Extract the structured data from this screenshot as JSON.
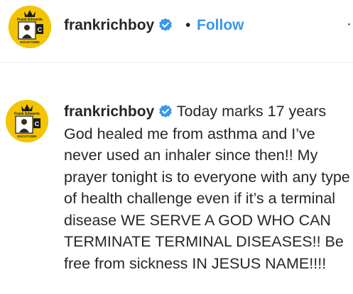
{
  "post_header": {
    "username": "frankrichboy",
    "separator": "•",
    "follow_label": "Follow",
    "more_label": "·"
  },
  "avatar": {
    "top_text": "Frank Edwards",
    "letter": "C",
    "bottom_text": "ROCKTOWN",
    "bg_color": "#f3c400",
    "crown_color": "#1a1a1a"
  },
  "comment": {
    "username": "frankrichboy",
    "text": "Today marks 17 years God healed me from asthma and I’ve never used an inhaler since then!! My prayer tonight is to everyone with any type of health challenge even if it’s a terminal disease WE SERVE A GOD WHO CAN TERMINATE TERMINAL DISEASES!! Be free from sickness IN JESUS NAME!!!!"
  },
  "colors": {
    "verified": "#3897f0",
    "follow": "#3897f0",
    "text": "#262626"
  }
}
